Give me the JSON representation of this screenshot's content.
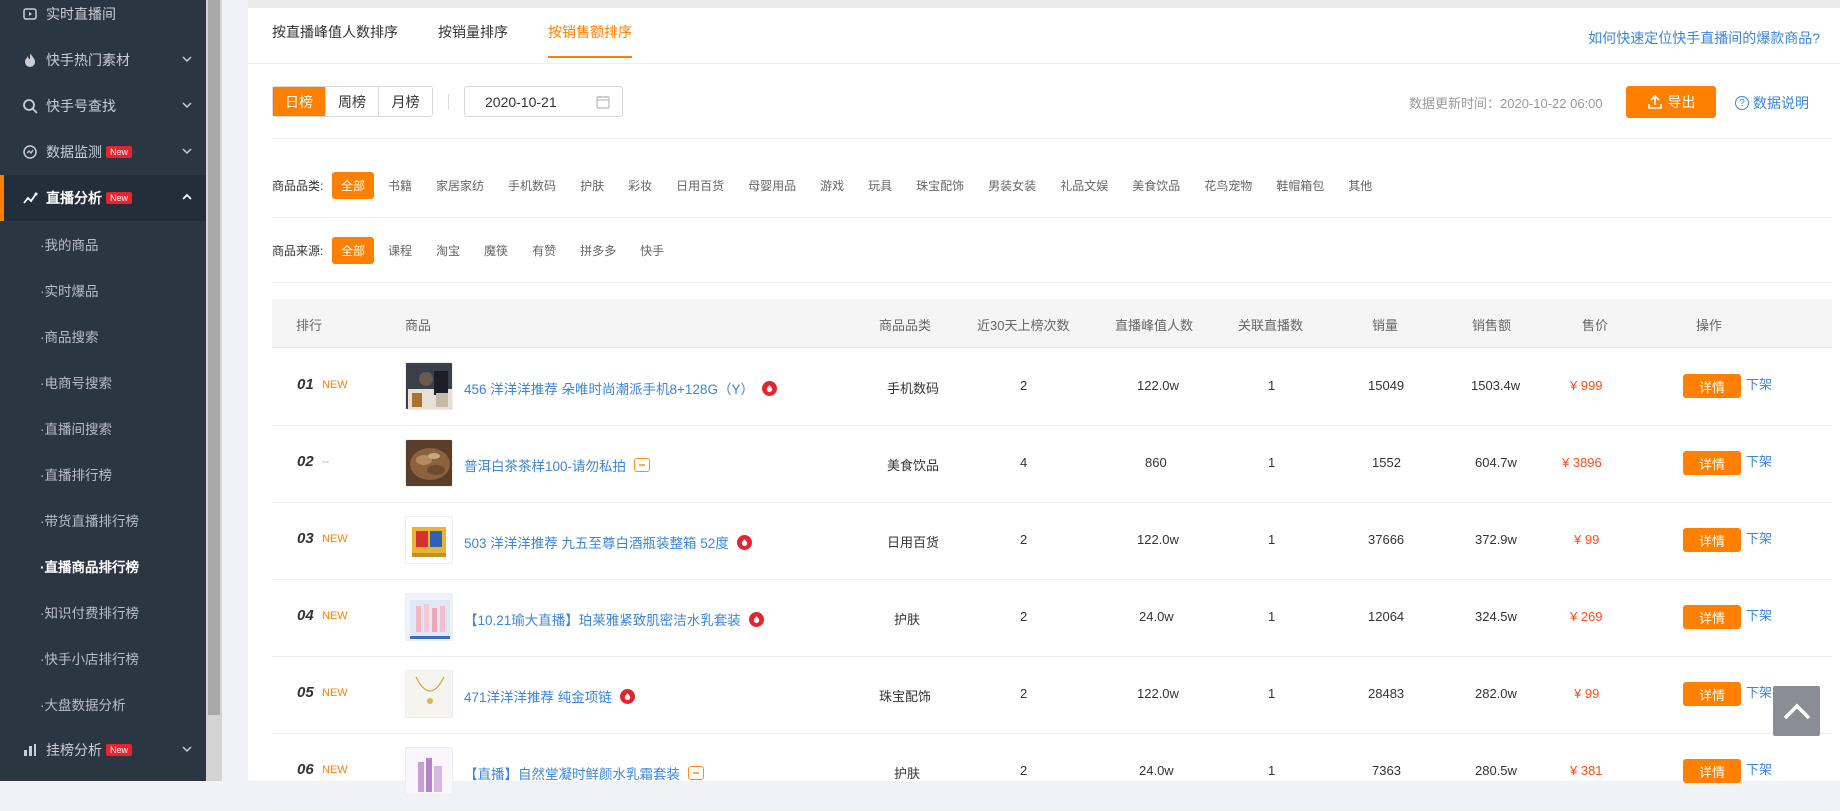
{
  "sidebar": {
    "items": [
      {
        "label": "实时直播间",
        "icon": "live-icon"
      },
      {
        "label": "快手热门素材",
        "icon": "fire-icon"
      },
      {
        "label": "快手号查找",
        "icon": "search-icon"
      },
      {
        "label": "数据监测",
        "icon": "monitor-icon",
        "badge": "New"
      },
      {
        "label": "直播分析",
        "icon": "trend-icon",
        "badge": "New"
      }
    ],
    "sub_items": [
      "我的商品",
      "实时爆品",
      "商品搜索",
      "电商号搜索",
      "直播间搜索",
      "直播排行榜",
      "带货直播排行榜",
      "直播商品排行榜",
      "知识付费排行榜",
      "快手小店排行榜",
      "大盘数据分析"
    ],
    "bottom_item": {
      "label": "挂榜分析",
      "badge": "New",
      "icon": "bar-chart-icon"
    }
  },
  "tabs": [
    "按直播峰值人数排序",
    "按销量排序",
    "按销售额排序"
  ],
  "help_link": "如何快速定位快手直播间的爆款商品?",
  "rank_buttons": [
    "日榜",
    "周榜",
    "月榜"
  ],
  "date_value": "2020-10-21",
  "update_time": "数据更新时间：2020-10-22 06:00",
  "export_label": "导出",
  "data_help_label": "数据说明",
  "filters": {
    "category_label": "商品品类:",
    "categories": [
      "全部",
      "书籍",
      "家居家纺",
      "手机数码",
      "护肤",
      "彩妆",
      "日用百货",
      "母婴用品",
      "游戏",
      "玩具",
      "珠宝配饰",
      "男装女装",
      "礼品文娱",
      "美食饮品",
      "花鸟宠物",
      "鞋帽箱包",
      "其他"
    ],
    "source_label": "商品来源:",
    "sources": [
      "全部",
      "课程",
      "淘宝",
      "魔筷",
      "有赞",
      "拼多多",
      "快手"
    ]
  },
  "table": {
    "headers": [
      "排行",
      "商品",
      "商品品类",
      "近30天上榜次数",
      "直播峰值人数",
      "关联直播数",
      "销量",
      "销售额",
      "售价",
      "操作"
    ],
    "detail_label": "详情",
    "off_label": "下架",
    "rows": [
      {
        "rank": "01",
        "tag": "NEW",
        "name": "456 洋洋洋推荐 朵唯时尚潮派手机8+128G（Y）",
        "icon": "hot",
        "category": "手机数码",
        "count30": "2",
        "peak": "122.0w",
        "live": "1",
        "sales": "15049",
        "revenue": "1503.4w",
        "price": "¥ 999"
      },
      {
        "rank": "02",
        "tag": "--",
        "name": "普洱白茶茶样100-请勿私拍",
        "icon": "shop",
        "category": "美食饮品",
        "count30": "4",
        "peak": "860",
        "live": "1",
        "sales": "1552",
        "revenue": "604.7w",
        "price": "¥ 3896"
      },
      {
        "rank": "03",
        "tag": "NEW",
        "name": "503 洋洋洋推荐 九五至尊白酒瓶装整箱 52度",
        "icon": "hot",
        "category": "日用百货",
        "count30": "2",
        "peak": "122.0w",
        "live": "1",
        "sales": "37666",
        "revenue": "372.9w",
        "price": "¥ 99"
      },
      {
        "rank": "04",
        "tag": "NEW",
        "name": "【10.21瑜大直播】珀莱雅紧致肌密洁水乳套装",
        "icon": "hot",
        "category": "护肤",
        "count30": "2",
        "peak": "24.0w",
        "live": "1",
        "sales": "12064",
        "revenue": "324.5w",
        "price": "¥ 269"
      },
      {
        "rank": "05",
        "tag": "NEW",
        "name": "471洋洋洋推荐 纯金项链",
        "icon": "hot",
        "category": "珠宝配饰",
        "count30": "2",
        "peak": "122.0w",
        "live": "1",
        "sales": "28483",
        "revenue": "282.0w",
        "price": "¥ 99"
      },
      {
        "rank": "06",
        "tag": "NEW",
        "name": "【直播】自然堂凝时鲜颜水乳霜套装",
        "icon": "shop",
        "category": "护肤",
        "count30": "2",
        "peak": "24.0w",
        "live": "1",
        "sales": "7363",
        "revenue": "280.5w",
        "price": "¥ 381"
      }
    ]
  },
  "colors": {
    "accent": "#ff7f00",
    "link": "#3b86d9",
    "sidebar": "#2b3643",
    "price": "#ff4d1a"
  }
}
